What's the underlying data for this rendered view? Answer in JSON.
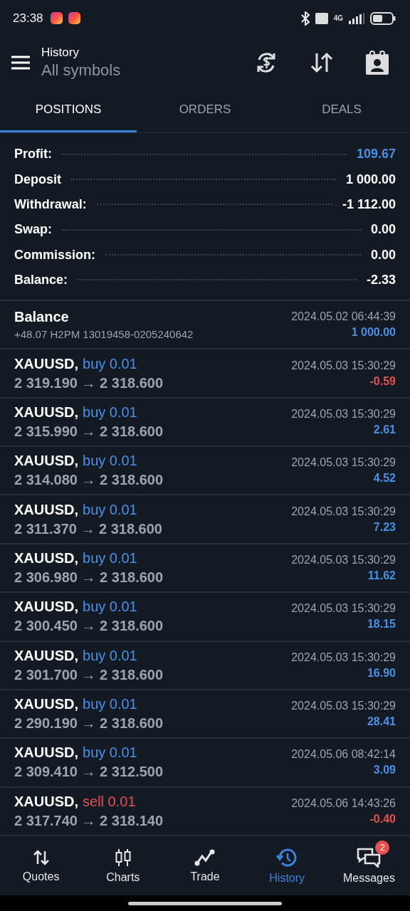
{
  "status_bar": {
    "time": "23:38",
    "network": "4G"
  },
  "header": {
    "title": "History",
    "subtitle": "All symbols"
  },
  "tabs": [
    {
      "label": "POSITIONS",
      "selected": true
    },
    {
      "label": "ORDERS",
      "selected": false
    },
    {
      "label": "DEALS",
      "selected": false
    }
  ],
  "summary": [
    {
      "label": "Profit:",
      "value": "109.67",
      "highlight": true
    },
    {
      "label": "Deposit",
      "value": "1 000.00",
      "highlight": false
    },
    {
      "label": "Withdrawal:",
      "value": "-1 112.00",
      "highlight": false
    },
    {
      "label": "Swap:",
      "value": "0.00",
      "highlight": false
    },
    {
      "label": "Commission:",
      "value": "0.00",
      "highlight": false
    },
    {
      "label": "Balance:",
      "value": "-2.33",
      "highlight": false
    }
  ],
  "balance_entry": {
    "title": "Balance",
    "comment": "+48.07 H2PM 13019458-0205240642",
    "time": "2024.05.02 06:44:39",
    "amount": "1 000.00"
  },
  "positions": [
    {
      "symbol": "XAUUSD,",
      "side": "buy 0.01",
      "kind": "buy",
      "prices": "2 319.190 → 2 318.600",
      "time": "2024.05.03 15:30:29",
      "profit": "-0.59",
      "loss": true
    },
    {
      "symbol": "XAUUSD,",
      "side": "buy 0.01",
      "kind": "buy",
      "prices": "2 315.990 → 2 318.600",
      "time": "2024.05.03 15:30:29",
      "profit": "2.61",
      "loss": false
    },
    {
      "symbol": "XAUUSD,",
      "side": "buy 0.01",
      "kind": "buy",
      "prices": "2 314.080 → 2 318.600",
      "time": "2024.05.03 15:30:29",
      "profit": "4.52",
      "loss": false
    },
    {
      "symbol": "XAUUSD,",
      "side": "buy 0.01",
      "kind": "buy",
      "prices": "2 311.370 → 2 318.600",
      "time": "2024.05.03 15:30:29",
      "profit": "7.23",
      "loss": false
    },
    {
      "symbol": "XAUUSD,",
      "side": "buy 0.01",
      "kind": "buy",
      "prices": "2 306.980 → 2 318.600",
      "time": "2024.05.03 15:30:29",
      "profit": "11.62",
      "loss": false
    },
    {
      "symbol": "XAUUSD,",
      "side": "buy 0.01",
      "kind": "buy",
      "prices": "2 300.450 → 2 318.600",
      "time": "2024.05.03 15:30:29",
      "profit": "18.15",
      "loss": false
    },
    {
      "symbol": "XAUUSD,",
      "side": "buy 0.01",
      "kind": "buy",
      "prices": "2 301.700 → 2 318.600",
      "time": "2024.05.03 15:30:29",
      "profit": "16.90",
      "loss": false
    },
    {
      "symbol": "XAUUSD,",
      "side": "buy 0.01",
      "kind": "buy",
      "prices": "2 290.190 → 2 318.600",
      "time": "2024.05.03 15:30:29",
      "profit": "28.41",
      "loss": false
    },
    {
      "symbol": "XAUUSD,",
      "side": "buy 0.01",
      "kind": "buy",
      "prices": "2 309.410 → 2 312.500",
      "time": "2024.05.06 08:42:14",
      "profit": "3.09",
      "loss": false
    },
    {
      "symbol": "XAUUSD,",
      "side": "sell 0.01",
      "kind": "sell",
      "prices": "2 317.740 → 2 318.140",
      "time": "2024.05.06 14:43:26",
      "profit": "-0.40",
      "loss": true
    }
  ],
  "bottom_nav": [
    {
      "label": "Quotes",
      "kind": "quotes",
      "selected": false
    },
    {
      "label": "Charts",
      "kind": "charts",
      "selected": false
    },
    {
      "label": "Trade",
      "kind": "trade",
      "selected": false
    },
    {
      "label": "History",
      "kind": "history",
      "selected": true
    },
    {
      "label": "Messages",
      "kind": "messages",
      "selected": false,
      "badge": "2"
    }
  ]
}
